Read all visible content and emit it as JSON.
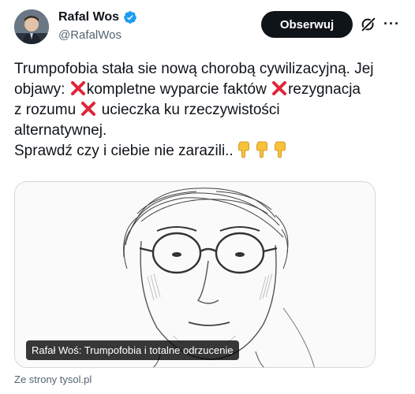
{
  "author": {
    "name": "Rafal Wos",
    "handle": "@RafalWos",
    "verified": true,
    "avatar_icon": "avatar-photo"
  },
  "actions": {
    "follow_label": "Obserwuj",
    "grok_icon": "grok-icon",
    "more_icon": "more-options-icon"
  },
  "tweet": {
    "line1": "Trumpofobia stała sie nową chorobą cywilizacyjną. Jej",
    "line2_a": "objawy: ",
    "line2_b": "kompletne wyparcie faktów ",
    "line2_c": "rezygnacja",
    "line3_a": "z rozumu ",
    "line3_b": " ucieczka ku rzeczywistości",
    "line4": "alternatywnej.",
    "line5": "Sprawdź czy i ciebie nie zarazili..",
    "emoji_x": "cross-mark",
    "emoji_hand": "hand-pointing-down"
  },
  "card": {
    "caption": "Rafał Woś: Trumpofobia i totalne odrzucenie",
    "image": "portrait-illustration"
  },
  "source": {
    "label": "Ze strony tysol.pl"
  },
  "colors": {
    "follow_bg": "#0f1419",
    "verified": "#1d9bf0",
    "cross": "#e0243a",
    "hand": "#f7c13a",
    "secondary_text": "#536471"
  }
}
